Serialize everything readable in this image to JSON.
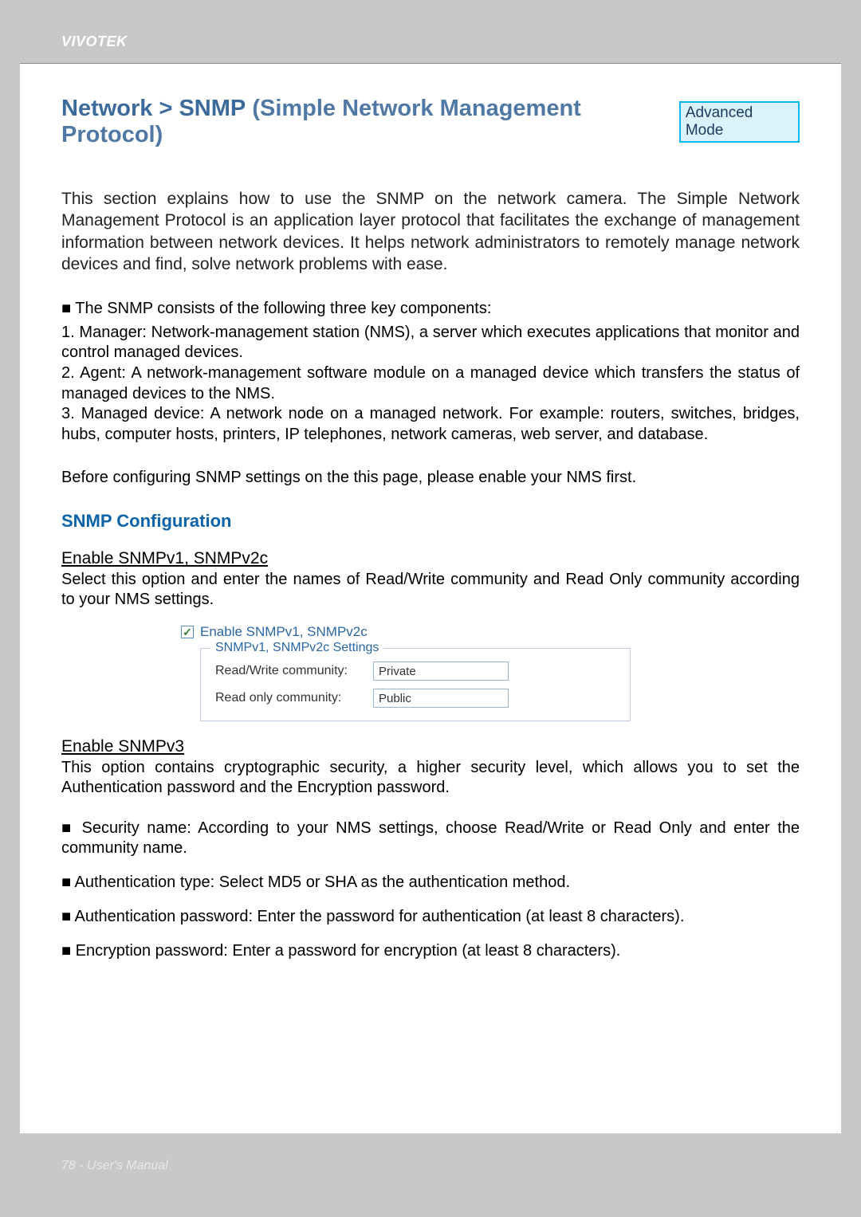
{
  "brand": "VIVOTEK",
  "title": {
    "breadcrumb": "Network > SNMP",
    "expansion": "(Simple Network Management Protocol)"
  },
  "mode_badge": "Advanced Mode",
  "intro": "This section explains how to use the SNMP on the network camera. The Simple Network Management Protocol is an application layer protocol that facilitates the exchange of management information between network devices. It helps network administrators to remotely manage network devices and find, solve network problems with ease.",
  "components": {
    "lead": "■ The SNMP consists of the following three key components:",
    "items": [
      "1. Manager: Network-management station (NMS), a server which executes applications that monitor and control managed devices.",
      "2. Agent: A network-management software module on a managed device which transfers the status of managed devices to the NMS.",
      "3. Managed device: A network node on a managed network. For example: routers, switches, bridges, hubs, computer hosts, printers, IP telephones, network cameras, web server, and database."
    ]
  },
  "before_note": "Before configuring SNMP settings on the this page, please enable your NMS first.",
  "section_title": "SNMP Configuration",
  "v1v2c": {
    "heading": "Enable SNMPv1, SNMPv2c",
    "desc": "Select this option and enter the names of Read/Write community and Read Only community according to your NMS settings.",
    "checkbox_label": "Enable SNMPv1, SNMPv2c",
    "checkbox_checked": true,
    "fieldset_legend": "SNMPv1, SNMPv2c Settings",
    "rw_label": "Read/Write community:",
    "rw_value": "Private",
    "ro_label": "Read only community:",
    "ro_value": "Public"
  },
  "v3": {
    "heading": "Enable SNMPv3",
    "desc": "This option contains cryptographic security, a higher security level, which allows you to set the Authentication password and the Encryption password.",
    "bullets": [
      "■ Security name: According to your NMS settings, choose Read/Write or Read Only and enter the community name.",
      "■ Authentication type: Select MD5 or SHA as the authentication method.",
      "■ Authentication password: Enter the password for authentication (at least 8 characters).",
      "■ Encryption password: Enter a password for encryption (at least 8 characters)."
    ]
  },
  "footer": "78 - User's Manual"
}
